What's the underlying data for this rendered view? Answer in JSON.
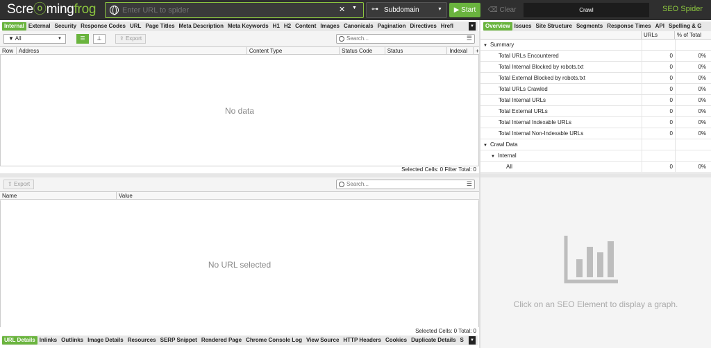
{
  "top": {
    "logo_pre": "Scre",
    "logo_mid": "ming",
    "logo_post": "frog",
    "url_placeholder": "Enter URL to spider",
    "mode": "Subdomain",
    "start": "Start",
    "clear": "Clear",
    "crawl": "Crawl",
    "brand": "SEO Spider"
  },
  "left_tabs": [
    "Internal",
    "External",
    "Security",
    "Response Codes",
    "URL",
    "Page Titles",
    "Meta Description",
    "Meta Keywords",
    "H1",
    "H2",
    "Content",
    "Images",
    "Canonicals",
    "Pagination",
    "Directives",
    "Hrefl"
  ],
  "toolbar": {
    "filter": "All",
    "export": "Export",
    "search_placeholder": "Search..."
  },
  "grid": {
    "columns": [
      "Row",
      "Address",
      "Content Type",
      "Status Code",
      "Status",
      "Indexal"
    ],
    "empty": "No data",
    "status": "Selected Cells:  0  Filter Total:  0"
  },
  "lower": {
    "export": "Export",
    "search_placeholder": "Search...",
    "columns": [
      "Name",
      "Value"
    ],
    "empty": "No URL selected",
    "status": "Selected Cells:  0  Total:  0"
  },
  "bottom_tabs": [
    "URL Details",
    "Inlinks",
    "Outlinks",
    "Image Details",
    "Resources",
    "SERP Snippet",
    "Rendered Page",
    "Chrome Console Log",
    "View Source",
    "HTTP Headers",
    "Cookies",
    "Duplicate Details",
    "S"
  ],
  "right_tabs": [
    "Overview",
    "Issues",
    "Site Structure",
    "Segments",
    "Response Times",
    "API",
    "Spelling & G"
  ],
  "overview": {
    "columns": [
      "",
      "URLs",
      "% of Total"
    ],
    "rows": [
      {
        "label": "Summary",
        "urls": "",
        "pct": "",
        "level": 0,
        "group": true
      },
      {
        "label": "Total URLs Encountered",
        "urls": "0",
        "pct": "0%",
        "level": 2
      },
      {
        "label": "Total Internal Blocked by robots.txt",
        "urls": "0",
        "pct": "0%",
        "level": 2
      },
      {
        "label": "Total External Blocked by robots.txt",
        "urls": "0",
        "pct": "0%",
        "level": 2
      },
      {
        "label": "Total URLs Crawled",
        "urls": "0",
        "pct": "0%",
        "level": 2
      },
      {
        "label": "Total Internal URLs",
        "urls": "0",
        "pct": "0%",
        "level": 2
      },
      {
        "label": "Total External URLs",
        "urls": "0",
        "pct": "0%",
        "level": 2
      },
      {
        "label": "Total Internal Indexable URLs",
        "urls": "0",
        "pct": "0%",
        "level": 2
      },
      {
        "label": "Total Internal Non-Indexable URLs",
        "urls": "0",
        "pct": "0%",
        "level": 2
      },
      {
        "label": "Crawl Data",
        "urls": "",
        "pct": "",
        "level": 0,
        "group": true
      },
      {
        "label": "Internal",
        "urls": "",
        "pct": "",
        "level": 1,
        "group": true
      },
      {
        "label": "All",
        "urls": "0",
        "pct": "0%",
        "level": 3
      }
    ]
  },
  "graph": {
    "hint": "Click on an SEO Element to display a graph."
  },
  "colors": {
    "accent": "#6ab43e",
    "topbar": "#2f2f2f"
  }
}
